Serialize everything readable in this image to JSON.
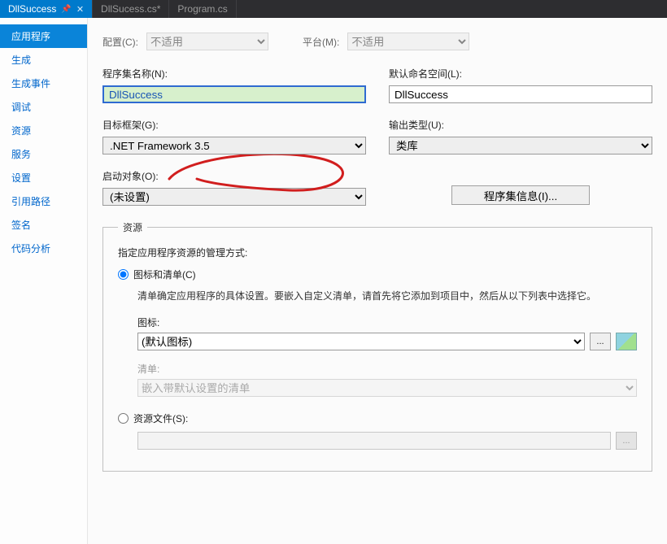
{
  "tabs": [
    {
      "label": "DllSuccess",
      "active": true
    },
    {
      "label": "DllSucess.cs*",
      "active": false
    },
    {
      "label": "Program.cs",
      "active": false
    }
  ],
  "sidenav": {
    "items": [
      "应用程序",
      "生成",
      "生成事件",
      "调试",
      "资源",
      "服务",
      "设置",
      "引用路径",
      "签名",
      "代码分析"
    ],
    "active_index": 0
  },
  "topcfg": {
    "config_label": "配置(C):",
    "config_value": "不适用",
    "platform_label": "平台(M):",
    "platform_value": "不适用"
  },
  "assembly_name": {
    "label": "程序集名称(N):",
    "value": "DllSuccess"
  },
  "default_namespace": {
    "label": "默认命名空间(L):",
    "value": "DllSuccess"
  },
  "target_framework": {
    "label": "目标框架(G):",
    "value": ".NET Framework 3.5"
  },
  "output_type": {
    "label": "输出类型(U):",
    "value": "类库"
  },
  "startup_object": {
    "label": "启动对象(O):",
    "value": "(未设置)"
  },
  "assembly_info_button": "程序集信息(I)...",
  "resources": {
    "legend": "资源",
    "heading": "指定应用程序资源的管理方式:",
    "radio_icon_label": "图标和清单(C)",
    "icon_desc": "清单确定应用程序的具体设置。要嵌入自定义清单，请首先将它添加到项目中，然后从以下列表中选择它。",
    "icon_label": "图标:",
    "icon_value": "(默认图标)",
    "browse_label": "...",
    "manifest_label": "清单:",
    "manifest_value": "嵌入带默认设置的清单",
    "radio_file_label": "资源文件(S):",
    "file_value": "",
    "file_browse_label": "..."
  }
}
